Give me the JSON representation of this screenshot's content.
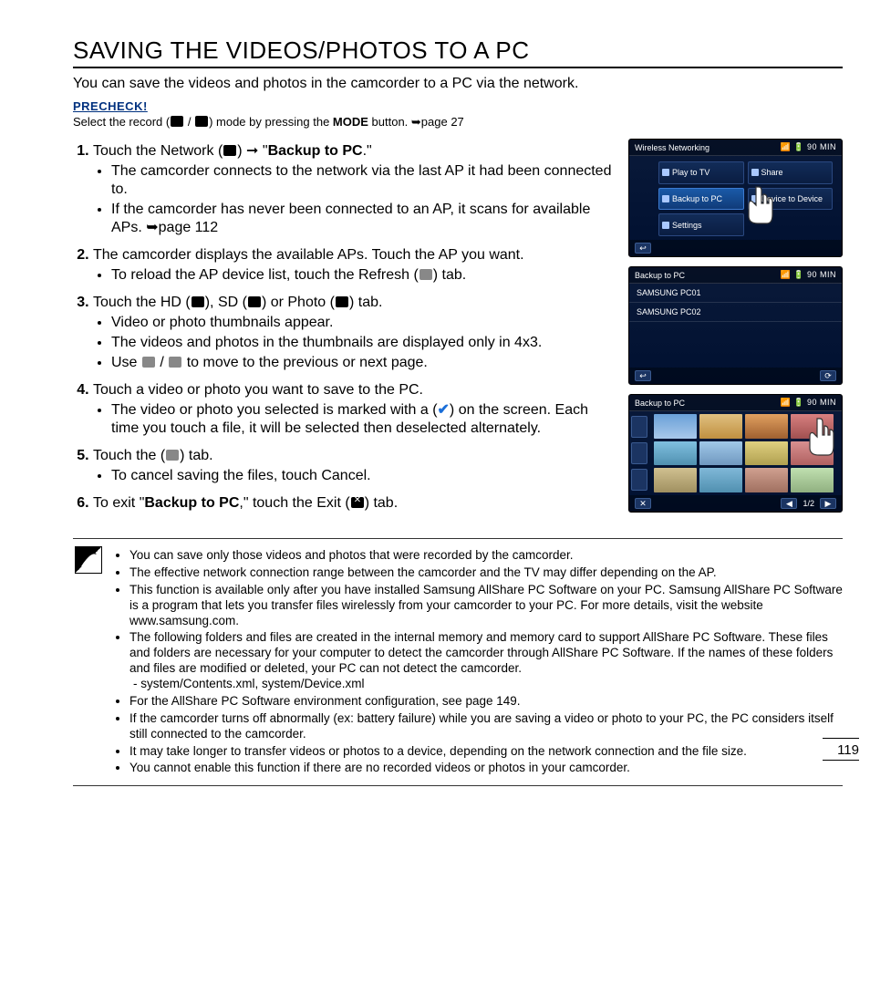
{
  "title": "SAVING THE VIDEOS/PHOTOS TO A PC",
  "intro": "You can save the videos and photos in the camcorder to a PC via the network.",
  "precheck": {
    "heading": "PRECHECK!",
    "prefix": "Select the record (",
    "mid": ") mode by pressing the ",
    "mode": "MODE",
    "suffix": " button. ➥page 27"
  },
  "steps": {
    "s1": {
      "prefix": "Touch the Network (",
      "mid": ") ➞ \"",
      "bold": "Backup to PC",
      "suffix": ".\"",
      "b1": "The camcorder connects to the network via the last AP it had been connected to.",
      "b2": "If the camcorder has never been connected to an AP, it scans for available APs. ➥page 112"
    },
    "s2": {
      "text": "The camcorder displays the available APs. Touch the AP you want.",
      "b1a": "To reload the AP device list, touch the Refresh (",
      "b1b": ") tab."
    },
    "s3": {
      "a": "Touch the HD (",
      "b": "), SD (",
      "c": ") or Photo (",
      "d": ") tab.",
      "b1": "Video or photo thumbnails appear.",
      "b2": "The videos and photos in the thumbnails are displayed only in 4x3.",
      "b3a": "Use ",
      "b3b": " to move to the previous or next page."
    },
    "s4": {
      "text": "Touch a video or photo you want to save to the PC.",
      "b1a": "The video or photo you selected is marked with a (",
      "b1b": ") on the screen. Each time you touch a file, it will be selected then deselected alternately."
    },
    "s5": {
      "a": "Touch the (",
      "b": ") tab.",
      "b1": "To cancel saving the files, touch Cancel."
    },
    "s6": {
      "a": "To exit \"",
      "bold": "Backup to PC",
      "b": ",\" touch the Exit (",
      "c": ") tab."
    }
  },
  "screens": {
    "s1": {
      "title": "Wireless Networking",
      "time": "90 MIN",
      "t1": "Play to TV",
      "t2": "Share",
      "t3": "Backup to PC",
      "t4": "Device to Device",
      "t5": "Settings"
    },
    "s2": {
      "title": "Backup to PC",
      "time": "90 MIN",
      "item1": "SAMSUNG PC01",
      "item2": "SAMSUNG PC02"
    },
    "s3": {
      "title": "Backup to PC",
      "time": "90 MIN",
      "page": "1/2"
    }
  },
  "notes": {
    "n1": "You can save only those videos and photos that were recorded by the camcorder.",
    "n2": "The effective network connection range between the camcorder and the TV may differ depending on the AP.",
    "n3": "This function is available only after you have installed Samsung AllShare PC Software on your PC. Samsung AllShare PC Software is a program that lets you transfer files wirelessly from your camcorder to your PC. For more details, visit the website www.samsung.com.",
    "n4": "The following folders and files are created in the internal memory and memory card to support AllShare PC Software. These files and folders are necessary for your computer to detect the camcorder through AllShare PC Software. If the names of these folders and files are modified or deleted, your PC can not detect the camcorder.",
    "n4sub": "-   system/Contents.xml, system/Device.xml",
    "n5": "For the AllShare PC Software environment configuration, see page 149.",
    "n6": "If the camcorder turns off abnormally (ex: battery failure) while you are saving a video or photo to your PC, the PC considers itself still connected to the camcorder.",
    "n7": "It may take longer to transfer videos or photos to a device, depending on the network connection and the file size.",
    "n8": "You cannot enable this function if there are no recorded videos or photos in your camcorder."
  },
  "pageNumber": "119"
}
